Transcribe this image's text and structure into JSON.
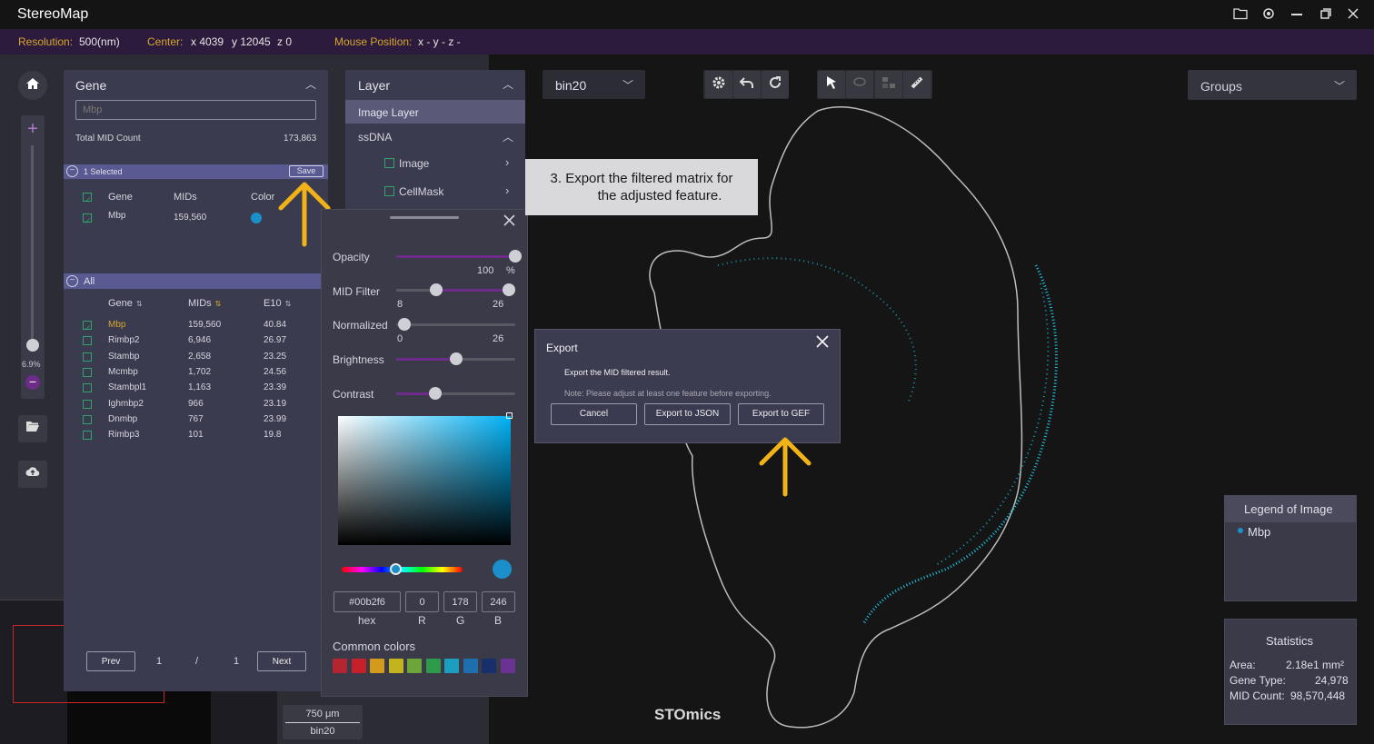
{
  "app": {
    "title": "StereoMap"
  },
  "infobar": {
    "resolution_label": "Resolution:",
    "resolution_value": "500(nm)",
    "center_label": "Center:",
    "center_x": "x 4039",
    "center_y": "y 12045",
    "center_z": "z 0",
    "mouse_label": "Mouse Position:",
    "mouse_value": "x -  y -  z -"
  },
  "zoom": {
    "percent": "6.9%"
  },
  "gene_panel": {
    "title": "Gene",
    "search_value": "Mbp",
    "total_label": "Total MID Count",
    "total_value": "173,863",
    "selected_label": "1 Selected",
    "save_label": "Save",
    "selected_headers": [
      "Gene",
      "MIDs",
      "Color"
    ],
    "selected_rows": [
      {
        "gene": "Mbp",
        "mids": "159,560",
        "color": "#1a8fc9"
      }
    ],
    "all_label": "All",
    "all_headers": [
      "Gene",
      "MIDs",
      "E10"
    ],
    "all_rows": [
      {
        "gene": "Mbp",
        "mids": "159,560",
        "e10": "40.84",
        "checked": true
      },
      {
        "gene": "Rimbp2",
        "mids": "6,946",
        "e10": "26.97",
        "checked": false
      },
      {
        "gene": "Stambp",
        "mids": "2,658",
        "e10": "23.25",
        "checked": false
      },
      {
        "gene": "Mcmbp",
        "mids": "1,702",
        "e10": "24.56",
        "checked": false
      },
      {
        "gene": "Stambpl1",
        "mids": "1,163",
        "e10": "23.39",
        "checked": false
      },
      {
        "gene": "Ighmbp2",
        "mids": "966",
        "e10": "23.19",
        "checked": false
      },
      {
        "gene": "Dnmbp",
        "mids": "767",
        "e10": "23.99",
        "checked": false
      },
      {
        "gene": "Rimbp3",
        "mids": "101",
        "e10": "19.8",
        "checked": false
      }
    ],
    "pagination": {
      "prev": "Prev",
      "page": "1",
      "sep": "/",
      "total": "1",
      "next": "Next"
    }
  },
  "layer_panel": {
    "title": "Layer",
    "image_layer": "Image Layer",
    "ssdna": "ssDNA",
    "image": "Image",
    "cellmask": "CellMask"
  },
  "adjust_panel": {
    "opacity_label": "Opacity",
    "opacity_value": "100",
    "opacity_unit": "%",
    "opacity_level": 1.0,
    "mid_label": "MID Filter",
    "mid_min": "8",
    "mid_max": "26",
    "normalized_label": "Normalized",
    "norm_min": "0",
    "norm_max": "26",
    "brightness_label": "Brightness",
    "brightness_level": 0.5,
    "contrast_label": "Contrast",
    "contrast_level": 0.33,
    "hex_value": "#00b2f6",
    "r_value": "0",
    "g_value": "178",
    "b_value": "246",
    "hex_label": "hex",
    "r_label": "R",
    "g_label": "G",
    "b_label": "B",
    "common_colors_label": "Common colors",
    "common_colors": [
      "#b3262f",
      "#c8202a",
      "#d39a1c",
      "#c3b41f",
      "#6ea53a",
      "#2d9b4a",
      "#1a9fc0",
      "#1e6fae",
      "#17306b",
      "#6a3391"
    ]
  },
  "tooltip": {
    "text_line1": "3.  Export the filtered matrix for",
    "text_line2": "the adjusted feature."
  },
  "export_dialog": {
    "title": "Export",
    "subtitle": "Export the MID filtered result.",
    "note": "Note: Please adjust at least one feature before exporting.",
    "cancel": "Cancel",
    "export_json": "Export to JSON",
    "export_gef": "Export to GEF"
  },
  "toolbar": {
    "bin_select": "bin20",
    "groups_select": "Groups"
  },
  "legend": {
    "title": "Legend of Image",
    "item": "Mbp",
    "item_color": "#1a8fc9"
  },
  "statistics": {
    "title": "Statistics",
    "area_label": "Area:",
    "area_value": "2.18e1 mm²",
    "gene_type_label": "Gene Type:",
    "gene_type_value": "24,978",
    "mid_count_label": "MID Count:",
    "mid_count_value": "98,570,448"
  },
  "scale": {
    "length": "750 μm",
    "bin": "bin20"
  },
  "brand": "STOmics",
  "colors": {
    "accent": "#6d2c8a",
    "highlight": "#d4a72c",
    "spot": "#1ec8e6"
  }
}
